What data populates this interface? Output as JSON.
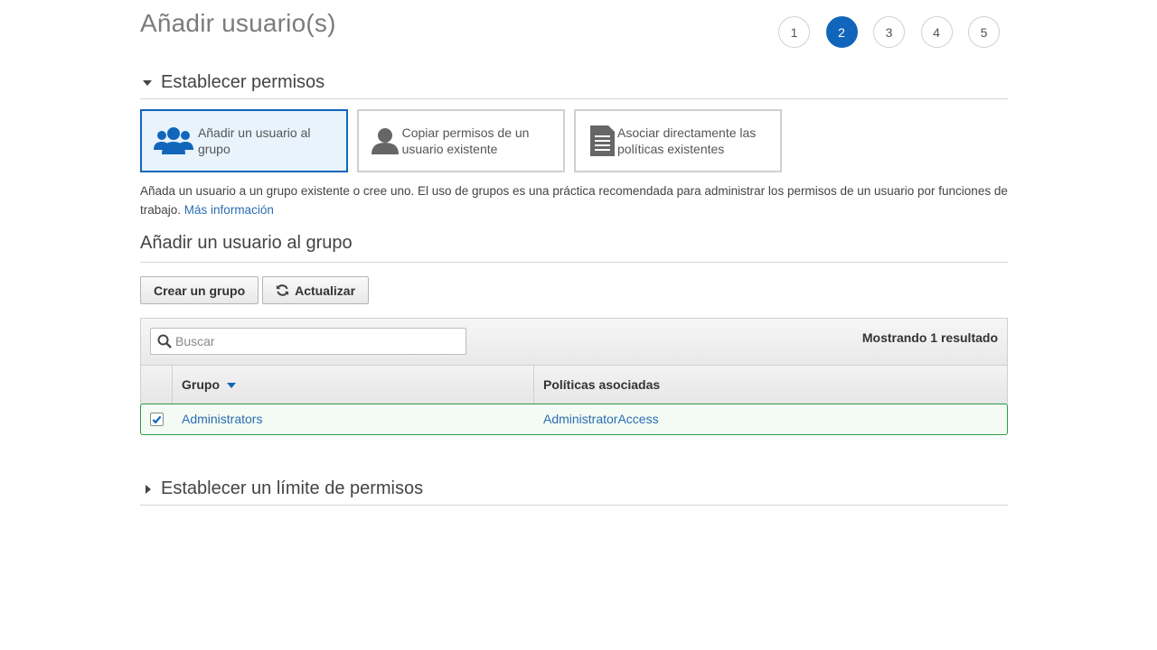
{
  "page": {
    "title": "Añadir usuario(s)"
  },
  "steps": [
    "1",
    "2",
    "3",
    "4",
    "5"
  ],
  "active_step": "2",
  "permissions_section": {
    "title": "Establecer permisos",
    "options": [
      {
        "label": "Añadir un usuario al grupo",
        "icon": "users-group-icon",
        "selected": true
      },
      {
        "label": "Copiar permisos de un usuario existente",
        "icon": "user-icon",
        "selected": false
      },
      {
        "label": "Asociar directamente las políticas existentes",
        "icon": "document-icon",
        "selected": false
      }
    ],
    "description": "Añada un usuario a un grupo existente o cree uno. El uso de grupos es una práctica recomendada para administrar los permisos de un usuario por funciones de trabajo.",
    "more_info_link": "Más información"
  },
  "group_section": {
    "title": "Añadir un usuario al grupo",
    "create_button": "Crear un grupo",
    "refresh_button": "Actualizar",
    "search_placeholder": "Buscar",
    "results_count": "Mostrando 1 resultado",
    "columns": {
      "group": "Grupo",
      "policies": "Políticas asociadas"
    },
    "rows": [
      {
        "group": "Administrators",
        "policies": "AdministratorAccess",
        "checked": true
      }
    ]
  },
  "boundary_section": {
    "title": "Establecer un límite de permisos"
  },
  "colors": {
    "accent": "#1166bb",
    "link": "#2a6cb1",
    "selected_row_border": "#2c9c45"
  }
}
